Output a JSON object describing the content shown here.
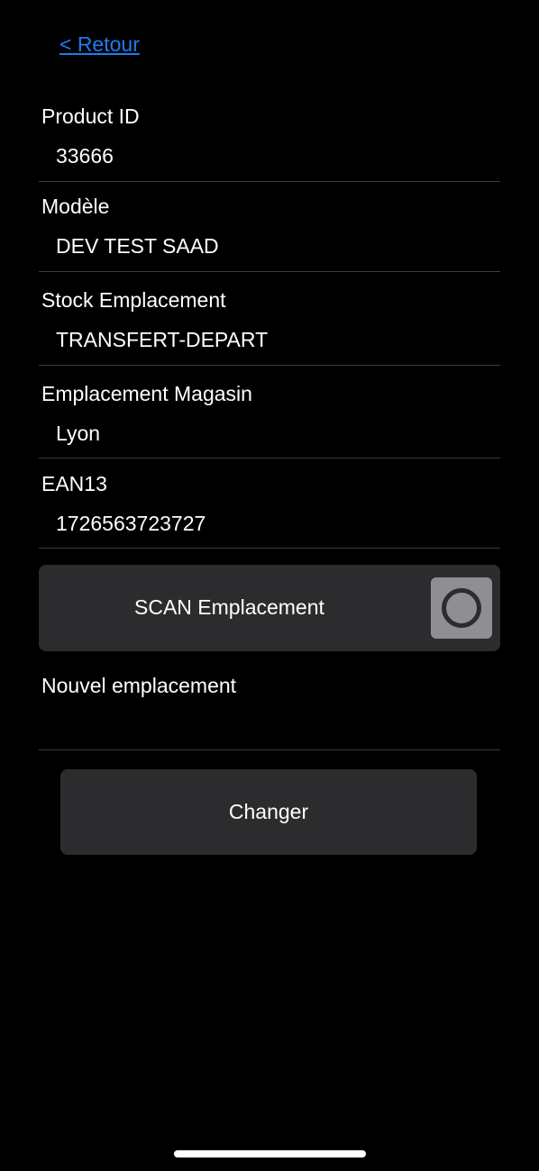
{
  "nav": {
    "back_label": "< Retour"
  },
  "fields": [
    {
      "label": "Product ID",
      "value": "33666"
    },
    {
      "label": "Modèle",
      "value": "DEV TEST SAAD"
    },
    {
      "label": "Stock Emplacement",
      "value": "TRANSFERT-DEPART"
    },
    {
      "label": "Emplacement Magasin",
      "value": "Lyon"
    },
    {
      "label": "EAN13",
      "value": "1726563723727"
    }
  ],
  "scan": {
    "label": "SCAN Emplacement",
    "toggle_icon": "radio-ring-icon",
    "toggle_on": false
  },
  "new_location": {
    "label": "Nouvel emplacement",
    "value": ""
  },
  "actions": {
    "change_label": "Changer"
  },
  "colors": {
    "background": "#000000",
    "link": "#1e7cf2",
    "surface": "#2c2c2e",
    "toggle": "#8e8e93",
    "divider": "#3a3a3a"
  }
}
